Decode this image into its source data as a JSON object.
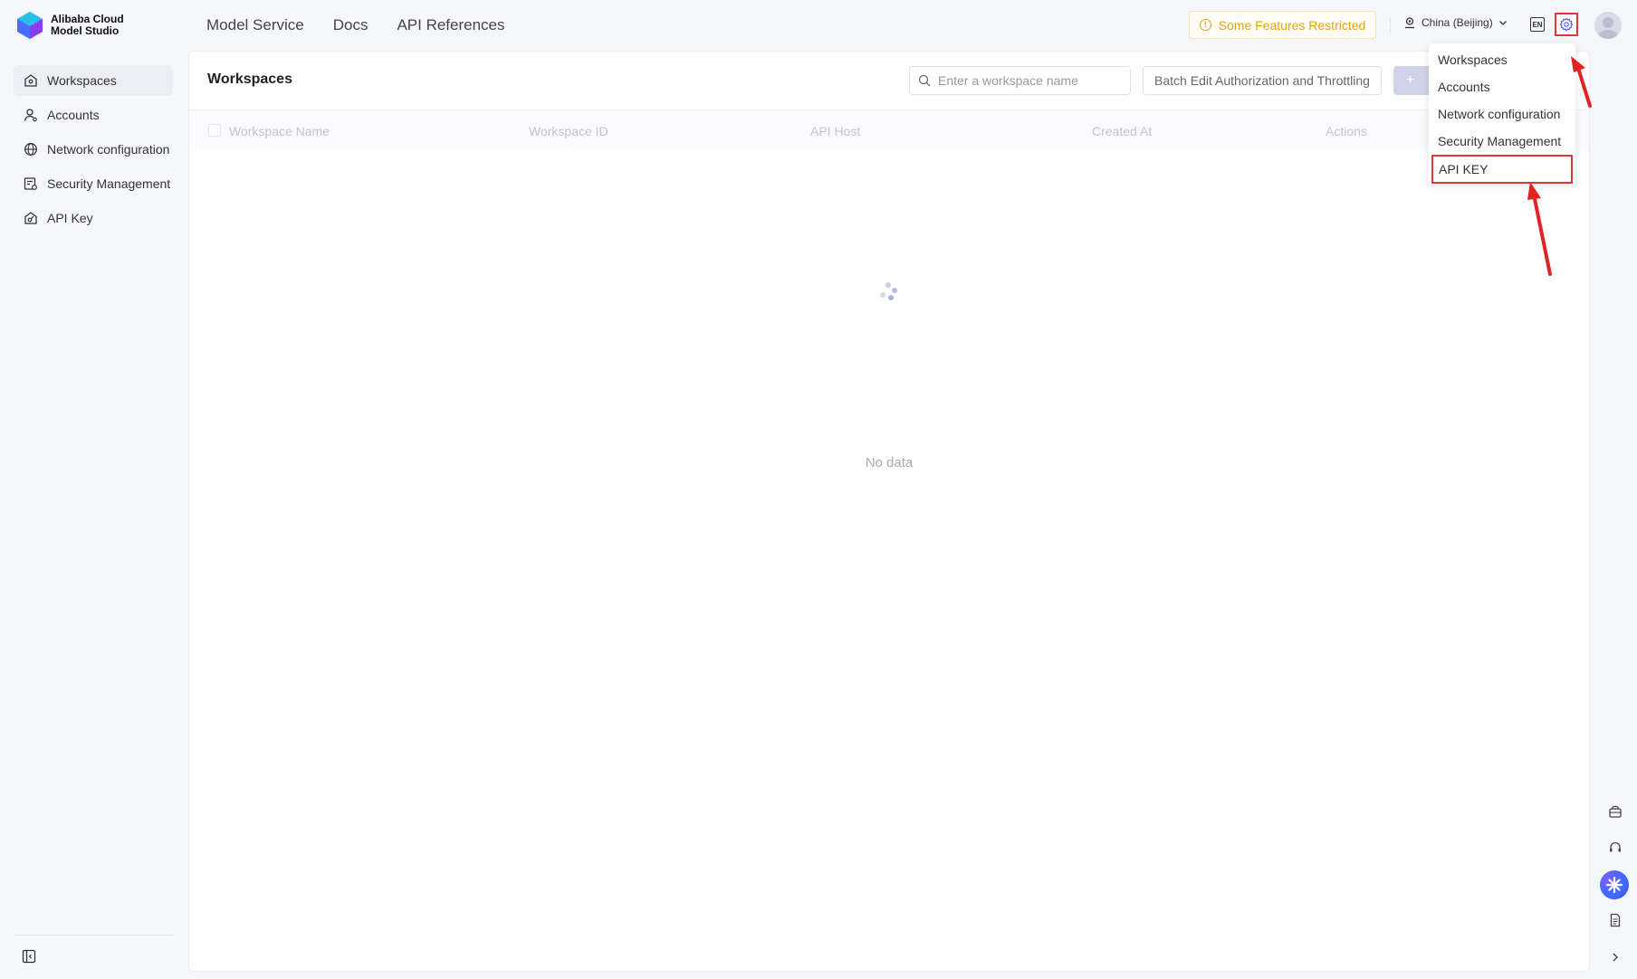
{
  "brand": {
    "line1": "Alibaba Cloud",
    "line2": "Model Studio"
  },
  "nav": {
    "items": [
      "Model Service",
      "Docs",
      "API References"
    ]
  },
  "header": {
    "restricted_label": "Some Features Restricted",
    "region_label": "China (Beijing)",
    "lang_label": "EN"
  },
  "sidebar": {
    "items": [
      {
        "label": "Workspaces",
        "icon": "workspace-icon"
      },
      {
        "label": "Accounts",
        "icon": "user-icon"
      },
      {
        "label": "Network configuration",
        "icon": "globe-icon"
      },
      {
        "label": "Security Management",
        "icon": "shield-icon"
      },
      {
        "label": "API Key",
        "icon": "key-icon"
      }
    ]
  },
  "main": {
    "title": "Workspaces",
    "search_placeholder": "Enter a workspace name",
    "batch_button": "Batch Edit Authorization and Throttling",
    "add_button": "+",
    "columns": [
      "Workspace Name",
      "Workspace ID",
      "API Host",
      "Created At",
      "Actions"
    ],
    "empty_text": "No data"
  },
  "dropdown": {
    "items": [
      "Workspaces",
      "Accounts",
      "Network configuration",
      "Security Management",
      "API KEY"
    ]
  },
  "colors": {
    "accent": "#d83a3a",
    "warning": "#e6a312",
    "primary_disabled": "#cfd3e8"
  }
}
